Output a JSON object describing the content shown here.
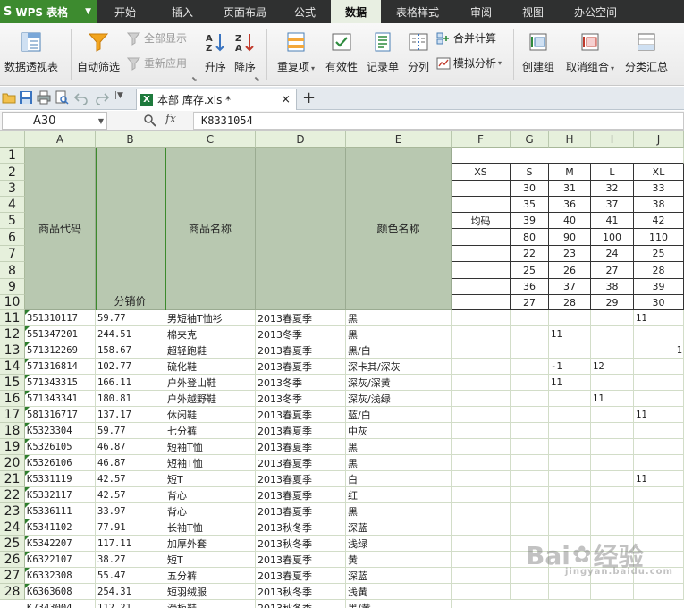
{
  "app": {
    "name": "WPS 表格",
    "logo": "S"
  },
  "menu": [
    "开始",
    "插入",
    "页面布局",
    "公式",
    "数据",
    "表格样式",
    "审阅",
    "视图",
    "办公空间"
  ],
  "menu_active": "数据",
  "ribbon": {
    "pivot": "数据透视表",
    "autofilter": "自动筛选",
    "show_all": "全部显示",
    "reapply": "重新应用",
    "sort_asc": "升序",
    "sort_desc": "降序",
    "duplicates": "重复项",
    "validity": "有效性",
    "record_form": "记录单",
    "split": "分列",
    "consolidate": "合并计算",
    "what_if": "模拟分析",
    "group": "创建组",
    "ungroup": "取消组合",
    "subtotal": "分类汇总"
  },
  "doc_tab": {
    "label": "本部 库存.xls *",
    "icon_letter": "X",
    "close": "×",
    "new_tab": "+"
  },
  "formula_bar": {
    "name_box": "A30",
    "fx": "fx",
    "content": "K8331054"
  },
  "columns": [
    "A",
    "B",
    "C",
    "D",
    "E",
    "F",
    "G",
    "H",
    "I",
    "J"
  ],
  "rows": [
    "1",
    "2",
    "3",
    "4",
    "5",
    "6",
    "7",
    "8",
    "9",
    "10",
    "11",
    "12",
    "13",
    "14",
    "15",
    "16",
    "17",
    "18",
    "19",
    "20",
    "21",
    "22",
    "23",
    "24",
    "25",
    "26",
    "27",
    "28"
  ],
  "header": {
    "code": "商品代码",
    "price": "分销价",
    "name": "商品名称",
    "color": "颜色名称",
    "avg_size": "均码"
  },
  "size_headers": [
    "XS",
    "S",
    "M",
    "L",
    "XL"
  ],
  "size_rows": [
    [
      "30",
      "31",
      "32",
      "33"
    ],
    [
      "35",
      "36",
      "37",
      "38"
    ],
    [
      "39",
      "40",
      "41",
      "42"
    ],
    [
      "80",
      "90",
      "100",
      "110"
    ],
    [
      "22",
      "23",
      "24",
      "25"
    ],
    [
      "25",
      "26",
      "27",
      "28"
    ],
    [
      "36",
      "37",
      "38",
      "39"
    ],
    [
      "27",
      "28",
      "29",
      "30"
    ]
  ],
  "items": [
    {
      "code": "351310117",
      "price": "59.77",
      "name": "男短袖T恤衫",
      "season": "2013春夏季",
      "color": "黑",
      "H": "",
      "I": "",
      "J": "11"
    },
    {
      "code": "551347201",
      "price": "244.51",
      "name": "棉夹克",
      "season": "2013冬季",
      "color": "黑",
      "H": "11",
      "I": "",
      "J": ""
    },
    {
      "code": "571312269",
      "price": "158.67",
      "name": "超轻跑鞋",
      "season": "2013春夏季",
      "color": "黑/白",
      "H": "",
      "I": "",
      "J": "",
      "K": "1"
    },
    {
      "code": "571316814",
      "price": "102.77",
      "name": "硫化鞋",
      "season": "2013春夏季",
      "color": "深卡其/深灰",
      "H": "-1",
      "I": "12",
      "J": ""
    },
    {
      "code": "571343315",
      "price": "166.11",
      "name": "户外登山鞋",
      "season": "2013冬季",
      "color": "深灰/深黄",
      "H": "11",
      "I": "",
      "J": ""
    },
    {
      "code": "571343341",
      "price": "180.81",
      "name": "户外越野鞋",
      "season": "2013冬季",
      "color": "深灰/浅绿",
      "H": "",
      "I": "11",
      "J": ""
    },
    {
      "code": "581316717",
      "price": "137.17",
      "name": "休闲鞋",
      "season": "2013春夏季",
      "color": "蓝/白",
      "H": "",
      "I": "",
      "J": "11"
    },
    {
      "code": "K5323304",
      "price": "59.77",
      "name": "七分裤",
      "season": "2013春夏季",
      "color": "中灰",
      "H": "",
      "I": "",
      "J": ""
    },
    {
      "code": "K5326105",
      "price": "46.87",
      "name": "短袖T恤",
      "season": "2013春夏季",
      "color": "黑",
      "H": "",
      "I": "",
      "J": ""
    },
    {
      "code": "K5326106",
      "price": "46.87",
      "name": "短袖T恤",
      "season": "2013春夏季",
      "color": "黑",
      "H": "",
      "I": "",
      "J": ""
    },
    {
      "code": "K5331119",
      "price": "42.57",
      "name": "短T",
      "season": "2013春夏季",
      "color": "白",
      "H": "",
      "I": "",
      "J": "11"
    },
    {
      "code": "K5332117",
      "price": "42.57",
      "name": "背心",
      "season": "2013春夏季",
      "color": "红",
      "H": "",
      "I": "",
      "J": ""
    },
    {
      "code": "K5336111",
      "price": "33.97",
      "name": "背心",
      "season": "2013春夏季",
      "color": "黑",
      "H": "",
      "I": "",
      "J": ""
    },
    {
      "code": "K5341102",
      "price": "77.91",
      "name": "长袖T恤",
      "season": "2013秋冬季",
      "color": "深蓝",
      "H": "",
      "I": "",
      "J": ""
    },
    {
      "code": "K5342207",
      "price": "117.11",
      "name": "加厚外套",
      "season": "2013秋冬季",
      "color": "浅绿",
      "H": "",
      "I": "",
      "J": ""
    },
    {
      "code": "K6322107",
      "price": "38.27",
      "name": "短T",
      "season": "2013春夏季",
      "color": "黄",
      "H": "",
      "I": "",
      "J": ""
    },
    {
      "code": "K6332308",
      "price": "55.47",
      "name": "五分裤",
      "season": "2013春夏季",
      "color": "深蓝",
      "H": "",
      "I": "",
      "J": ""
    },
    {
      "code": "K6363608",
      "price": "254.31",
      "name": "短羽绒服",
      "season": "2013秋冬季",
      "color": "浅黄",
      "H": "",
      "I": "",
      "J": ""
    },
    {
      "code": "K7343004",
      "price": "112.21",
      "name": "滑板鞋",
      "season": "2013秋冬季",
      "color": "黑/黄",
      "H": "",
      "I": "",
      "J": ""
    }
  ],
  "watermark": {
    "brand": "Bai",
    "brand2": "经验",
    "domain": "jingyan.baidu.com"
  }
}
